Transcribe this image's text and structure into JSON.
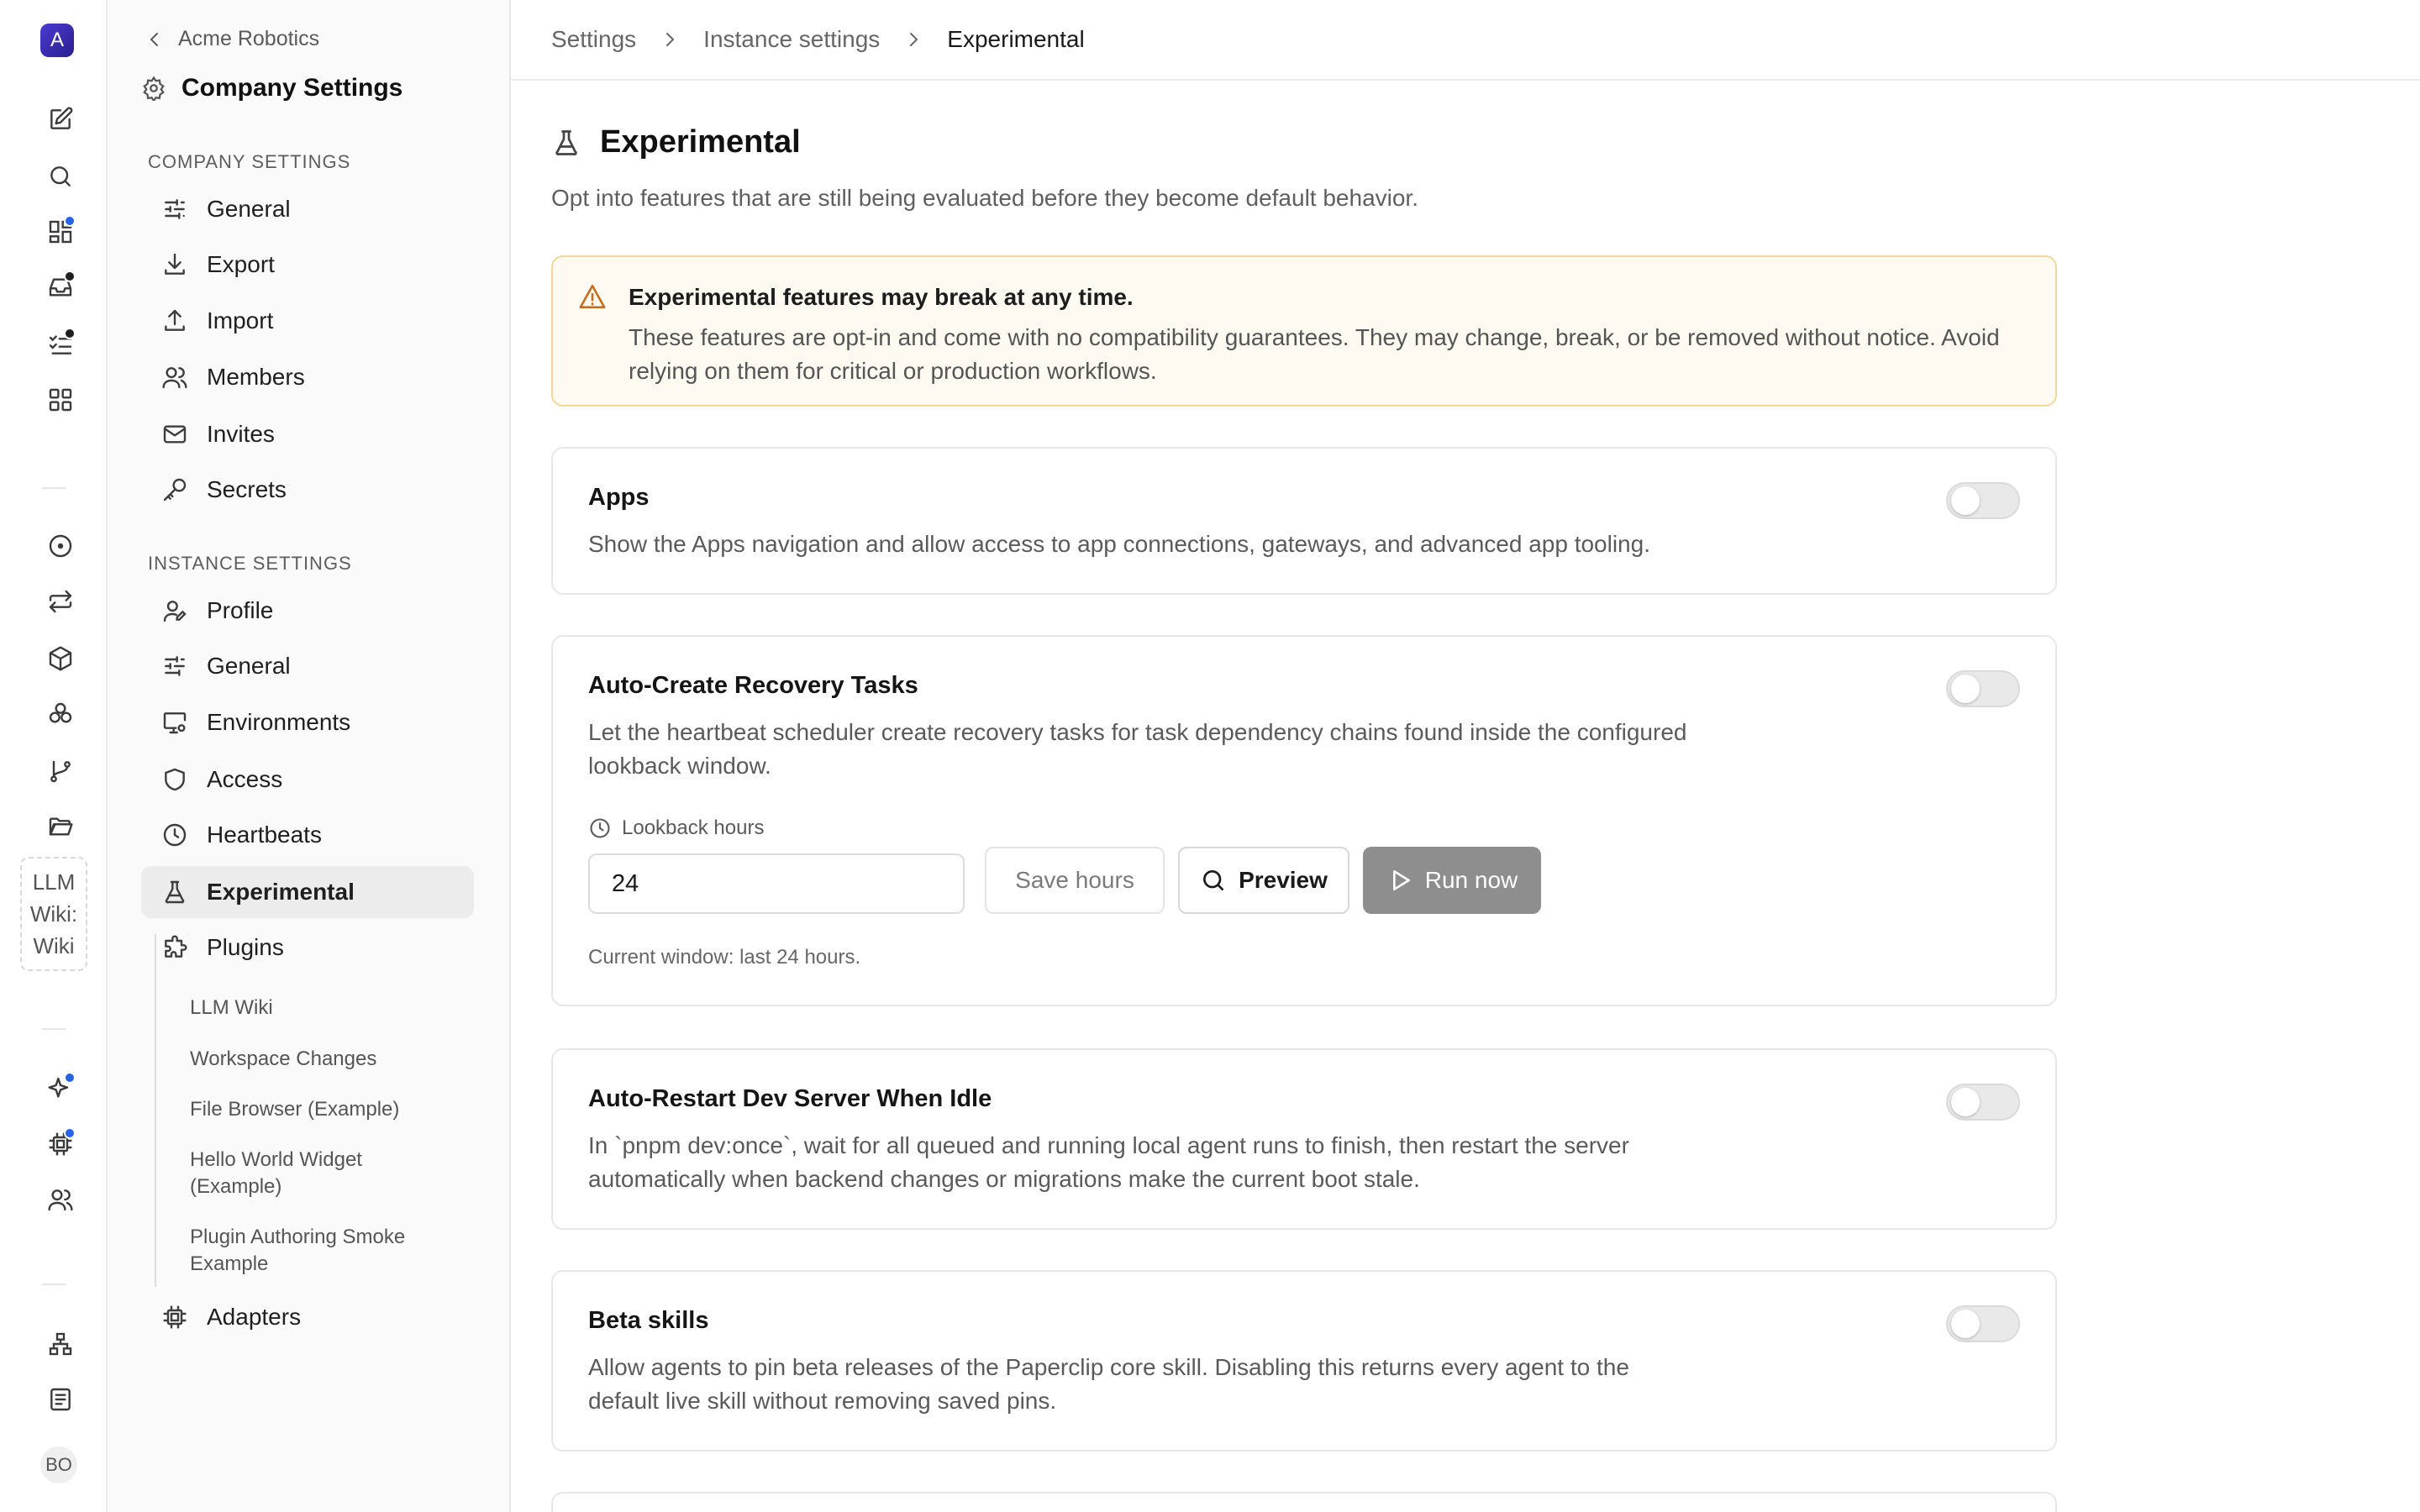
{
  "rail": {
    "logo_letter": "A",
    "llm_lines": [
      "LLM",
      "Wiki:",
      "Wiki"
    ],
    "avatar_initials": "BO",
    "badge_blue": "#2563eb",
    "badge_dark": "#1f1f1f"
  },
  "sidebar": {
    "back_label": "Acme Robotics",
    "title": "Company Settings",
    "company_section": "COMPANY SETTINGS",
    "company_items": [
      "General",
      "Export",
      "Import",
      "Members",
      "Invites",
      "Secrets"
    ],
    "instance_section": "INSTANCE SETTINGS",
    "instance_items": [
      "Profile",
      "General",
      "Environments",
      "Access",
      "Heartbeats",
      "Experimental",
      "Plugins"
    ],
    "plugin_items": [
      "LLM Wiki",
      "Workspace Changes",
      "File Browser (Example)",
      "Hello World Widget (Example)",
      "Plugin Authoring Smoke Example"
    ],
    "adapters_label": "Adapters"
  },
  "breadcrumb": [
    "Settings",
    "Instance settings",
    "Experimental"
  ],
  "page": {
    "title": "Experimental",
    "description": "Opt into features that are still being evaluated before they become default behavior."
  },
  "warning": {
    "title": "Experimental features may break at any time.",
    "body": "These features are opt-in and come with no compatibility guarantees. They may change, break, or be removed without notice. Avoid relying on them for critical or production workflows.",
    "accent": "#c86a1a"
  },
  "features": [
    {
      "title": "Apps",
      "description": "Show the Apps navigation and allow access to app connections, gateways, and advanced app tooling.",
      "enabled": false
    },
    {
      "title": "Auto-Create Recovery Tasks",
      "description": "Let the heartbeat scheduler create recovery tasks for task dependency chains found inside the configured lookback window.",
      "enabled": false,
      "lookback_label": "Lookback hours",
      "lookback_value": "24",
      "save_label": "Save hours",
      "preview_label": "Preview",
      "run_label": "Run now",
      "current_window": "Current window: last 24 hours."
    },
    {
      "title": "Auto-Restart Dev Server When Idle",
      "description": "In `pnpm dev:once`, wait for all queued and running local agent runs to finish, then restart the server automatically when backend changes or migrations make the current boot stale.",
      "enabled": false
    },
    {
      "title": "Beta skills",
      "description": "Allow agents to pin beta releases of the Paperclip core skill. Disabling this returns every agent to the default live skill without removing saved pins.",
      "enabled": false
    }
  ]
}
